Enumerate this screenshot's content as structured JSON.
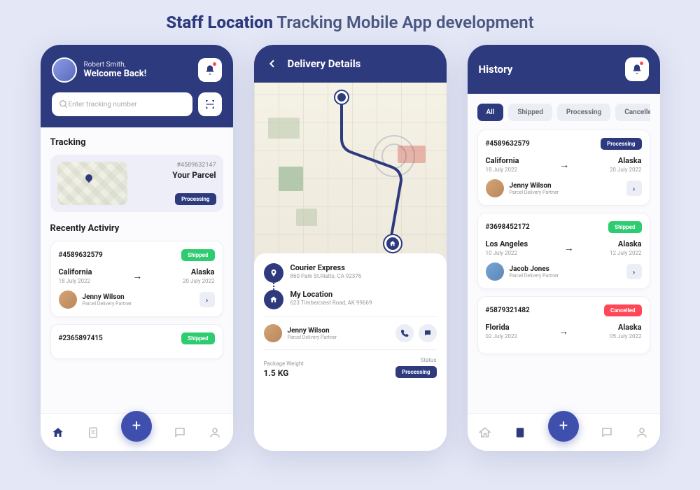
{
  "page_title_bold": "Staff Location",
  "page_title_rest": " Tracking Mobile App development",
  "home": {
    "user_name": "Robert Smith,",
    "welcome": "Welcome Back!",
    "search_placeholder": "Enter tracking number",
    "tracking_h": "Tracking",
    "track_id": "#4589632147",
    "track_label": "Your Parcel",
    "track_status": "Processing",
    "recent_h": "Recently Activiry",
    "a1_id": "#4589632579",
    "a1_status": "Shipped",
    "a1_from": "California",
    "a1_from_date": "18 July 2022",
    "a1_to": "Alaska",
    "a1_to_date": "20 July 2022",
    "a1_partner": "Jenny Wilson",
    "a1_role": "Parcel Delivery Partner",
    "a2_id": "#2365897415",
    "a2_status": "Shipped"
  },
  "detail": {
    "title": "Delivery Details",
    "courier": "Courier Express",
    "courier_addr": "860 Park St.Rialto, CA 92376",
    "myloc": "My Location",
    "myloc_addr": "623 Timbercrest Road, AK 99669",
    "partner": "Jenny Wilson",
    "partner_role": "Parcel Delivery Partner",
    "weight_l": "Package Weight",
    "weight_v": "1.5 KG",
    "status_l": "Status",
    "status_v": "Processing"
  },
  "history": {
    "title": "History",
    "tabs": [
      "All",
      "Shipped",
      "Processing",
      "Cancelled"
    ],
    "h1_id": "#4589632579",
    "h1_status": "Processing",
    "h1_from": "California",
    "h1_from_date": "18 July 2022",
    "h1_to": "Alaska",
    "h1_to_date": "20 July 2022",
    "h1_partner": "Jenny Wilson",
    "h1_role": "Parcel Delivery Partner",
    "h2_id": "#3698452172",
    "h2_status": "Shipped",
    "h2_from": "Los Angeles",
    "h2_from_date": "10 July 2022",
    "h2_to": "Alaska",
    "h2_to_date": "12 July 2022",
    "h2_partner": "Jacob Jones",
    "h2_role": "Parcel Delivery Partner",
    "h3_id": "#5879321482",
    "h3_status": "Cancelled",
    "h3_from": "Florida",
    "h3_from_date": "02 July 2022",
    "h3_to": "Alaska",
    "h3_to_date": "05 July 2022"
  }
}
